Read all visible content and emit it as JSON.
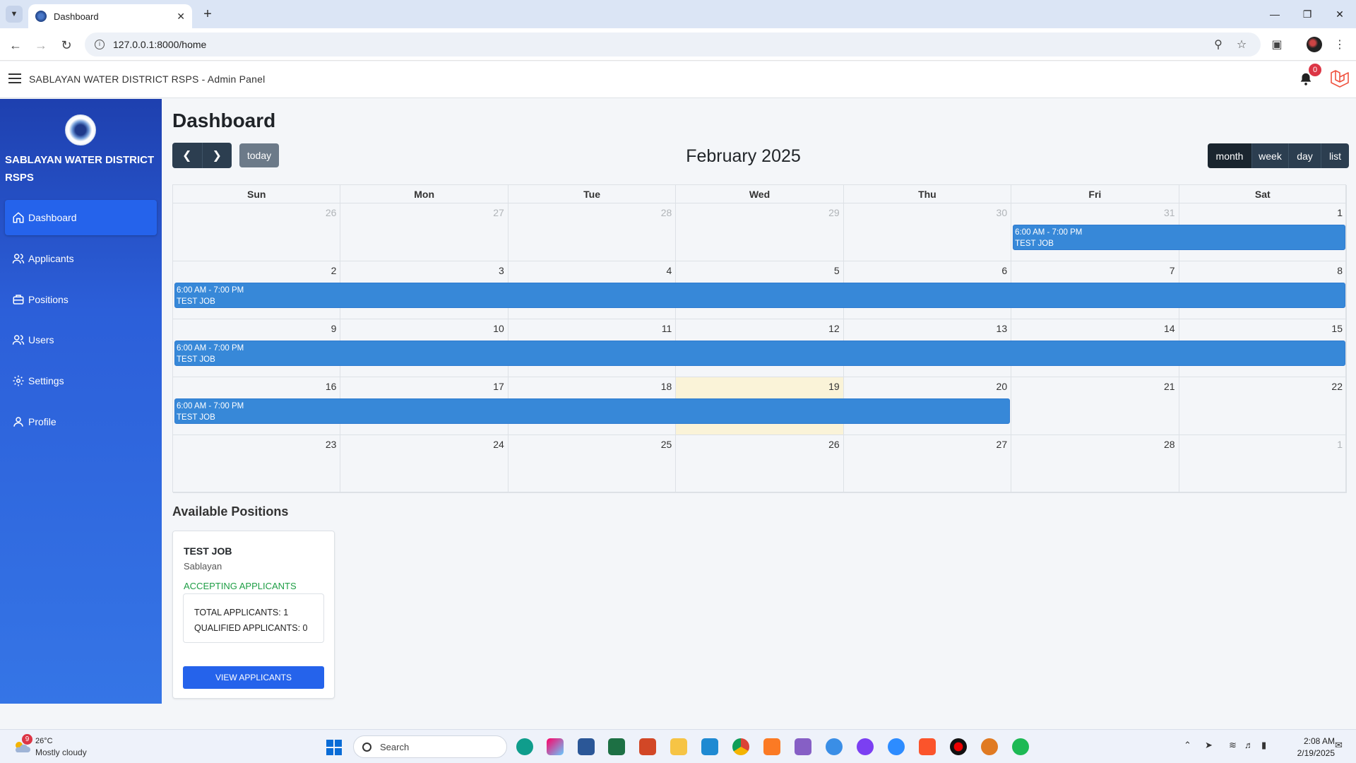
{
  "browser": {
    "tab_title": "Dashboard",
    "url": "127.0.0.1:8000/home"
  },
  "app": {
    "title": "SABLAYAN WATER DISTRICT RSPS - Admin Panel",
    "notification_count": "0"
  },
  "sidebar": {
    "org_name": "SABLAYAN WATER DISTRICT RSPS",
    "items": [
      {
        "label": "Dashboard",
        "icon": "home-icon",
        "active": true
      },
      {
        "label": "Applicants",
        "icon": "users-icon"
      },
      {
        "label": "Positions",
        "icon": "briefcase-icon"
      },
      {
        "label": "Users",
        "icon": "users-icon"
      },
      {
        "label": "Settings",
        "icon": "gear-icon"
      },
      {
        "label": "Profile",
        "icon": "user-icon"
      }
    ]
  },
  "main": {
    "page_title": "Dashboard",
    "calendar": {
      "today_label": "today",
      "title": "February 2025",
      "views": [
        "month",
        "week",
        "day",
        "list"
      ],
      "active_view": "month",
      "weekdays": [
        "Sun",
        "Mon",
        "Tue",
        "Wed",
        "Thu",
        "Fri",
        "Sat"
      ],
      "weeks": [
        [
          "26",
          "27",
          "28",
          "29",
          "30",
          "31",
          "1"
        ],
        [
          "2",
          "3",
          "4",
          "5",
          "6",
          "7",
          "8"
        ],
        [
          "9",
          "10",
          "11",
          "12",
          "13",
          "14",
          "15"
        ],
        [
          "16",
          "17",
          "18",
          "19",
          "20",
          "21",
          "22"
        ],
        [
          "23",
          "24",
          "25",
          "26",
          "27",
          "28",
          "1"
        ]
      ],
      "event_time": "6:00 AM - 7:00 PM",
      "event_title": "TEST JOB"
    },
    "positions": {
      "section_title": "Available Positions",
      "cards": [
        {
          "title": "TEST JOB",
          "location": "Sablayan",
          "status": "ACCEPTING APPLICANTS",
          "total_applicants": "TOTAL APPLICANTS: 1",
          "qualified_applicants": "QUALIFIED APPLICANTS: 0",
          "button_label": "VIEW APPLICANTS"
        }
      ]
    }
  },
  "taskbar": {
    "weather_badge": "9",
    "temperature": "26°C",
    "condition": "Mostly cloudy",
    "search_label": "Search",
    "time": "2:08 AM",
    "date": "2/19/2025"
  },
  "colors": {
    "sidebar_top": "#1e40af",
    "sidebar_bottom": "#3575e6",
    "event": "#3788d8",
    "today_highlight": "#faf3d8",
    "status_green": "#1e9e45"
  }
}
